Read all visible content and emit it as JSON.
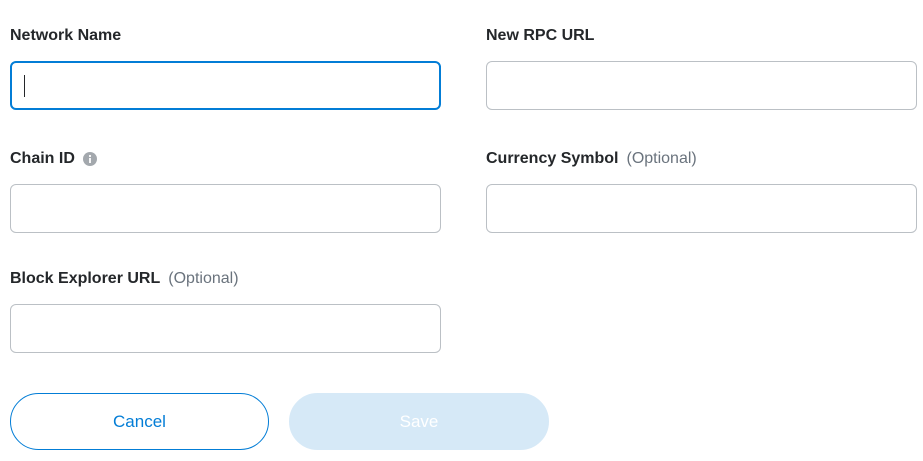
{
  "form": {
    "network_name": {
      "label": "Network Name",
      "value": ""
    },
    "rpc_url": {
      "label": "New RPC URL",
      "value": ""
    },
    "chain_id": {
      "label": "Chain ID",
      "value": "",
      "info_icon": "info-circle-icon"
    },
    "currency_symbol": {
      "label": "Currency Symbol",
      "optional": "(Optional)",
      "value": ""
    },
    "block_explorer": {
      "label": "Block Explorer URL",
      "optional": "(Optional)",
      "value": ""
    }
  },
  "actions": {
    "cancel_label": "Cancel",
    "save_label": "Save"
  },
  "colors": {
    "accent": "#037dd6",
    "save_disabled_bg": "#d6e9f7",
    "field_border": "#bbc0c5",
    "label_text": "#24272a",
    "optional_text": "#6a737d"
  }
}
